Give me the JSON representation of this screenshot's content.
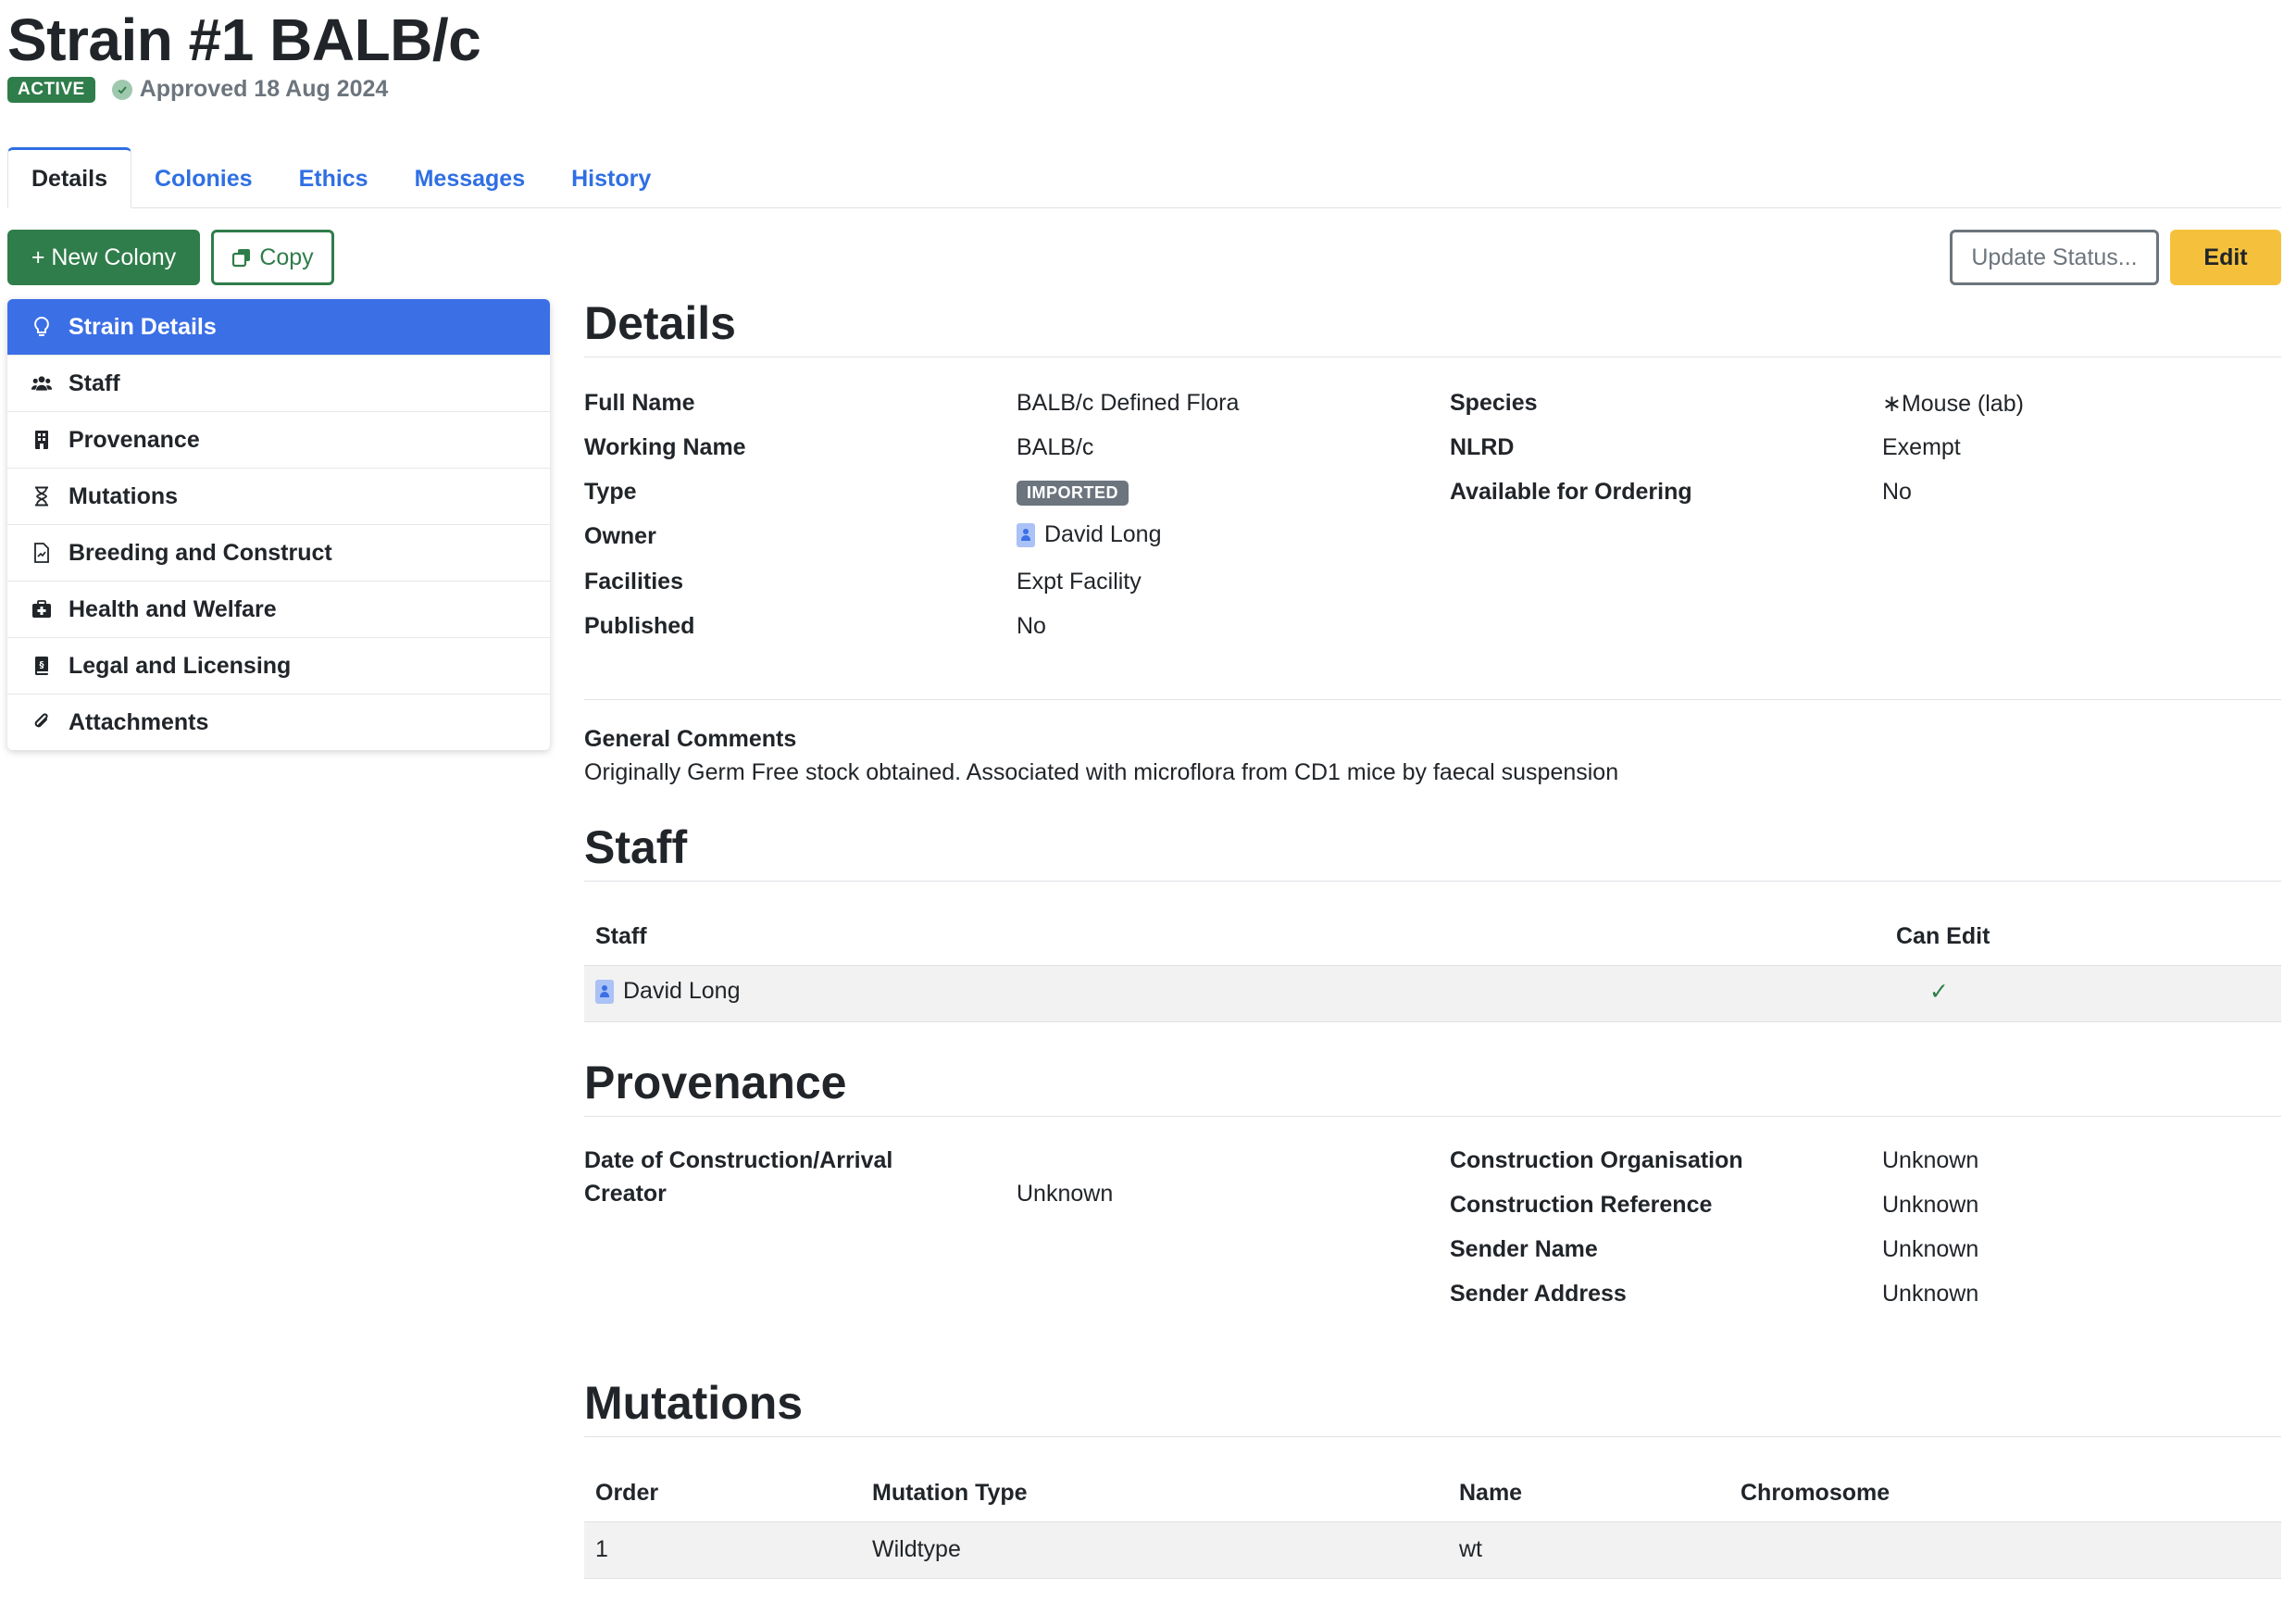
{
  "header": {
    "title": "Strain #1 BALB/c",
    "status_badge": "ACTIVE",
    "approved_text": "Approved 18 Aug 2024"
  },
  "tabs": [
    {
      "label": "Details",
      "active": true
    },
    {
      "label": "Colonies"
    },
    {
      "label": "Ethics"
    },
    {
      "label": "Messages"
    },
    {
      "label": "History"
    }
  ],
  "toolbar": {
    "new_colony": "+ New Colony",
    "copy": "Copy",
    "update_status": "Update Status...",
    "edit": "Edit"
  },
  "sidenav": {
    "items": [
      {
        "label": "Strain Details",
        "icon": "lightbulb-icon",
        "active": true
      },
      {
        "label": "Staff",
        "icon": "people-icon"
      },
      {
        "label": "Provenance",
        "icon": "building-icon"
      },
      {
        "label": "Mutations",
        "icon": "hourglass-icon"
      },
      {
        "label": "Breeding and Construct",
        "icon": "file-chart-icon"
      },
      {
        "label": "Health and Welfare",
        "icon": "medical-bag-icon"
      },
      {
        "label": "Legal and Licensing",
        "icon": "legal-book-icon"
      },
      {
        "label": "Attachments",
        "icon": "paperclip-icon"
      }
    ]
  },
  "details": {
    "title": "Details",
    "full_name_label": "Full Name",
    "full_name": "BALB/c Defined Flora",
    "working_name_label": "Working Name",
    "working_name": "BALB/c",
    "type_label": "Type",
    "type": "IMPORTED",
    "owner_label": "Owner",
    "owner": "David Long",
    "facilities_label": "Facilities",
    "facilities": "Expt Facility",
    "published_label": "Published",
    "published": "No",
    "species_label": "Species",
    "species": "∗Mouse (lab)",
    "nlrd_label": "NLRD",
    "nlrd": "Exempt",
    "available_label": "Available for Ordering",
    "available": "No",
    "comments_label": "General Comments",
    "comments": "Originally Germ Free stock obtained. Associated with microflora from CD1 mice by faecal suspension"
  },
  "staff": {
    "title": "Staff",
    "col_staff": "Staff",
    "col_can_edit": "Can Edit",
    "rows": [
      {
        "name": "David Long",
        "can_edit": "✓"
      }
    ]
  },
  "provenance": {
    "title": "Provenance",
    "date_label": "Date of Construction/Arrival",
    "creator_label": "Creator",
    "creator": "Unknown",
    "org_label": "Construction Organisation",
    "org": "Unknown",
    "ref_label": "Construction Reference",
    "ref": "Unknown",
    "sender_name_label": "Sender Name",
    "sender_name": "Unknown",
    "sender_address_label": "Sender Address",
    "sender_address": "Unknown"
  },
  "mutations": {
    "title": "Mutations",
    "col_order": "Order",
    "col_type": "Mutation Type",
    "col_name": "Name",
    "col_chromosome": "Chromosome",
    "rows": [
      {
        "order": "1",
        "type": "Wildtype",
        "name": "wt",
        "chromosome": ""
      }
    ]
  },
  "colors": {
    "primary_blue": "#3b6fe6",
    "success_green": "#2f7d4a",
    "warning_yellow": "#f5c13d",
    "secondary_gray": "#6c757d"
  }
}
